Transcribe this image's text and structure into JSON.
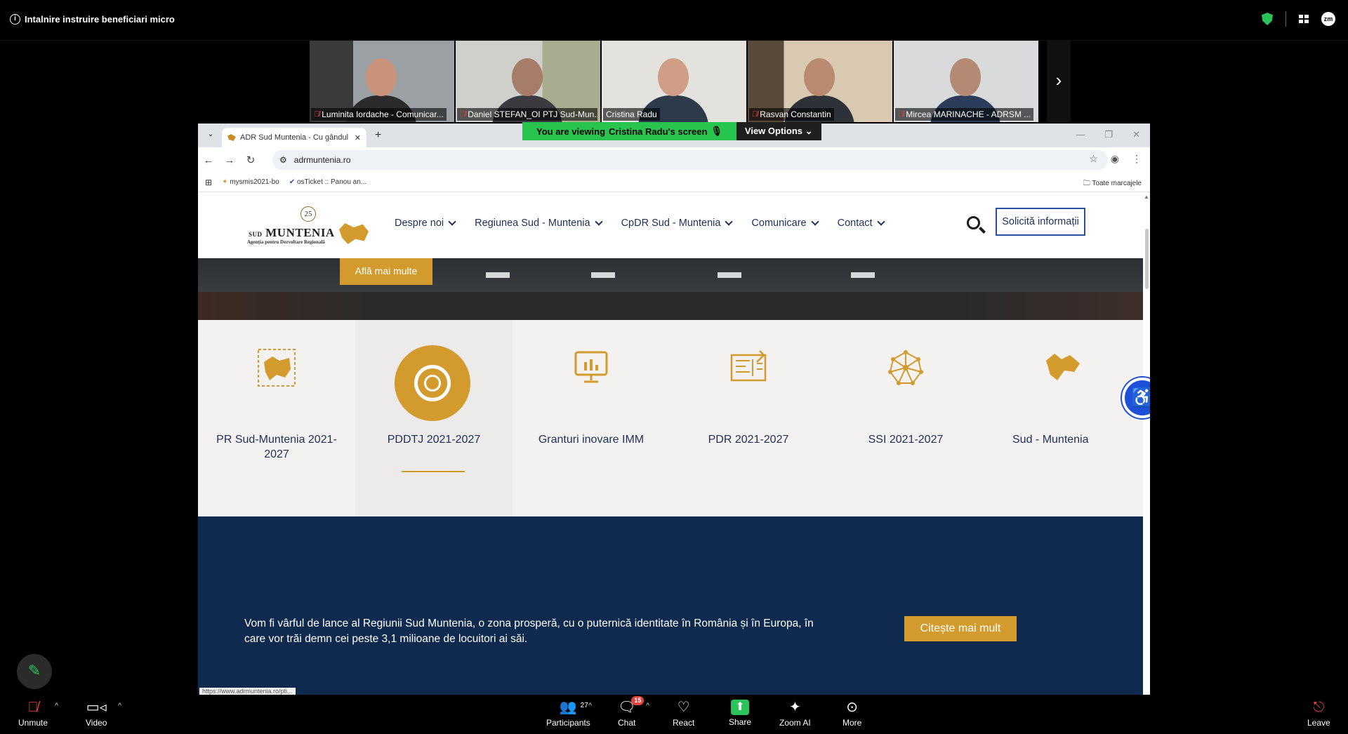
{
  "zoom": {
    "meeting_title": "Intalnire instruire beneficiari micro",
    "participants": [
      {
        "name": "Luminita Iordache - Comunicar...",
        "muted": true
      },
      {
        "name": "Daniel STEFAN_OI PTJ Sud-Mun...",
        "muted": true
      },
      {
        "name": "Cristina Radu",
        "muted": false,
        "active": true
      },
      {
        "name": "Rasvan Constantin",
        "muted": true
      },
      {
        "name": "Mircea MARINACHE - ADRSM ...",
        "muted": true
      }
    ],
    "share_banner": {
      "viewing_prefix": "You are viewing",
      "viewing_name": "Cristina Radu's screen",
      "view_options": "View Options"
    },
    "toolbar": {
      "unmute": "Unmute",
      "video": "Video",
      "participants": "Participants",
      "participants_count": "27",
      "chat": "Chat",
      "chat_badge": "15",
      "react": "React",
      "share": "Share",
      "zoom_ai": "Zoom AI",
      "more": "More",
      "leave": "Leave"
    }
  },
  "browser": {
    "tab_title": "ADR Sud Muntenia - Cu gândul",
    "url": "adrmuntenia.ro",
    "bookmarks": [
      "mysmis2021-bo",
      "osTicket :: Panou an..."
    ],
    "all_bookmarks": "Toate marcajele",
    "status_url": "https://www.adrmuntenia.ro/pti..."
  },
  "site": {
    "logo": {
      "anniv": "25",
      "name": "MUNTENIA",
      "prefix": "SUD",
      "subtitle": "Agenția pentru Dezvoltare Regională"
    },
    "nav": [
      "Despre noi",
      "Regiunea Sud - Muntenia",
      "CpDR Sud - Muntenia",
      "Comunicare",
      "Contact"
    ],
    "cta": "Solicită informații",
    "hero_button": "Află mai multe",
    "categories": [
      {
        "label": "PR Sud-Muntenia 2021-2027",
        "icon": "map-region-icon"
      },
      {
        "label": "PDDTJ 2021-2027",
        "icon": "pddtj-logo-icon",
        "selected": true
      },
      {
        "label": "Granturi inovare IMM",
        "icon": "presentation-chart-icon"
      },
      {
        "label": "PDR 2021-2027",
        "icon": "blueprint-icon"
      },
      {
        "label": "SSI 2021-2027",
        "icon": "network-icon"
      },
      {
        "label": "Sud - Muntenia",
        "icon": "region-map-icon"
      }
    ],
    "vision_text": "Vom fi vârful de lance al Regiunii Sud Muntenia, o zona prosperă, cu o puternică identitate în România și în Europa, în care vor trăi demn cei peste 3,1 milioane de locuitori ai săi.",
    "read_more": "Citește mai mult"
  },
  "colors": {
    "accent": "#d39a2e",
    "navy": "#10294f",
    "zoom_green": "#2ac45a",
    "link_blue": "#2a5199"
  }
}
